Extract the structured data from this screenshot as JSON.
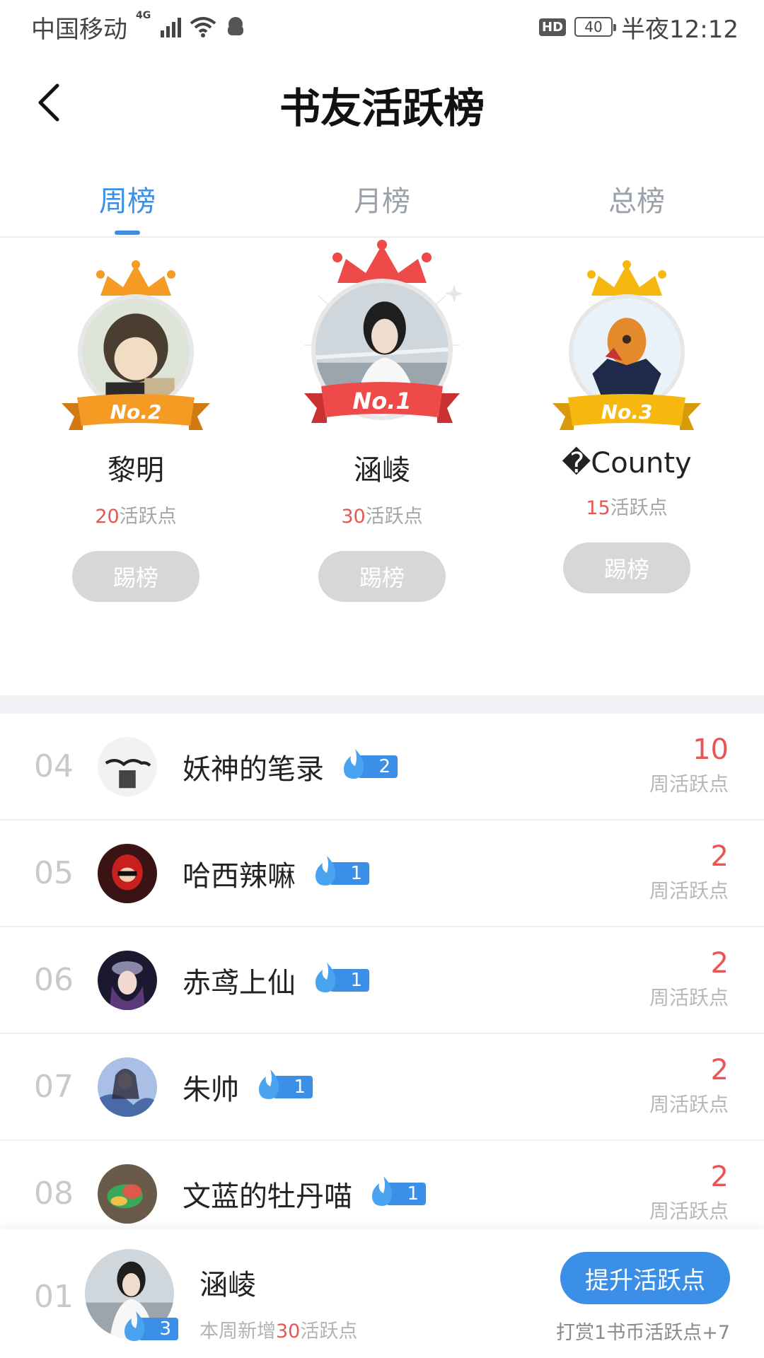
{
  "status_bar": {
    "carrier": "中国移动",
    "network": "4G",
    "hd": "HD",
    "battery": "40",
    "time": "半夜12:12"
  },
  "header": {
    "title": "书友活跃榜",
    "back_icon": "chevron-left-icon"
  },
  "tabs": [
    {
      "label": "周榜",
      "active": true
    },
    {
      "label": "月榜",
      "active": false
    },
    {
      "label": "总榜",
      "active": false
    }
  ],
  "podium": {
    "first": {
      "rank": "No.1",
      "name": "涵崚",
      "points": "30",
      "points_unit": "活跃点",
      "button": "踢榜",
      "color": "#ee4a4a"
    },
    "second": {
      "rank": "No.2",
      "name": "黎明",
      "points": "20",
      "points_unit": "活跃点",
      "button": "踢榜",
      "color": "#f59a23"
    },
    "third": {
      "rank": "No.3",
      "name": "�County",
      "points": "15",
      "points_unit": "活跃点",
      "button": "踢榜",
      "color": "#f6b80f"
    }
  },
  "list": [
    {
      "rank": "04",
      "name": "妖神的笔录",
      "level": "2",
      "points": "10",
      "points_label": "周活跃点"
    },
    {
      "rank": "05",
      "name": "哈西辣嘛",
      "level": "1",
      "points": "2",
      "points_label": "周活跃点"
    },
    {
      "rank": "06",
      "name": "赤鸢上仙",
      "level": "1",
      "points": "2",
      "points_label": "周活跃点"
    },
    {
      "rank": "07",
      "name": "朱帅",
      "level": "1",
      "points": "2",
      "points_label": "周活跃点"
    },
    {
      "rank": "08",
      "name": "文蓝的牡丹喵",
      "level": "1",
      "points": "2",
      "points_label": "周活跃点"
    }
  ],
  "me": {
    "rank": "01",
    "name": "涵崚",
    "level": "3",
    "sub_prefix": "本周新增",
    "sub_points": "30",
    "sub_suffix": "活跃点",
    "button": "提升活跃点",
    "tip": "打赏1书币活跃点+7"
  },
  "colors": {
    "accent": "#3b8fe6",
    "points": "#e85555"
  }
}
